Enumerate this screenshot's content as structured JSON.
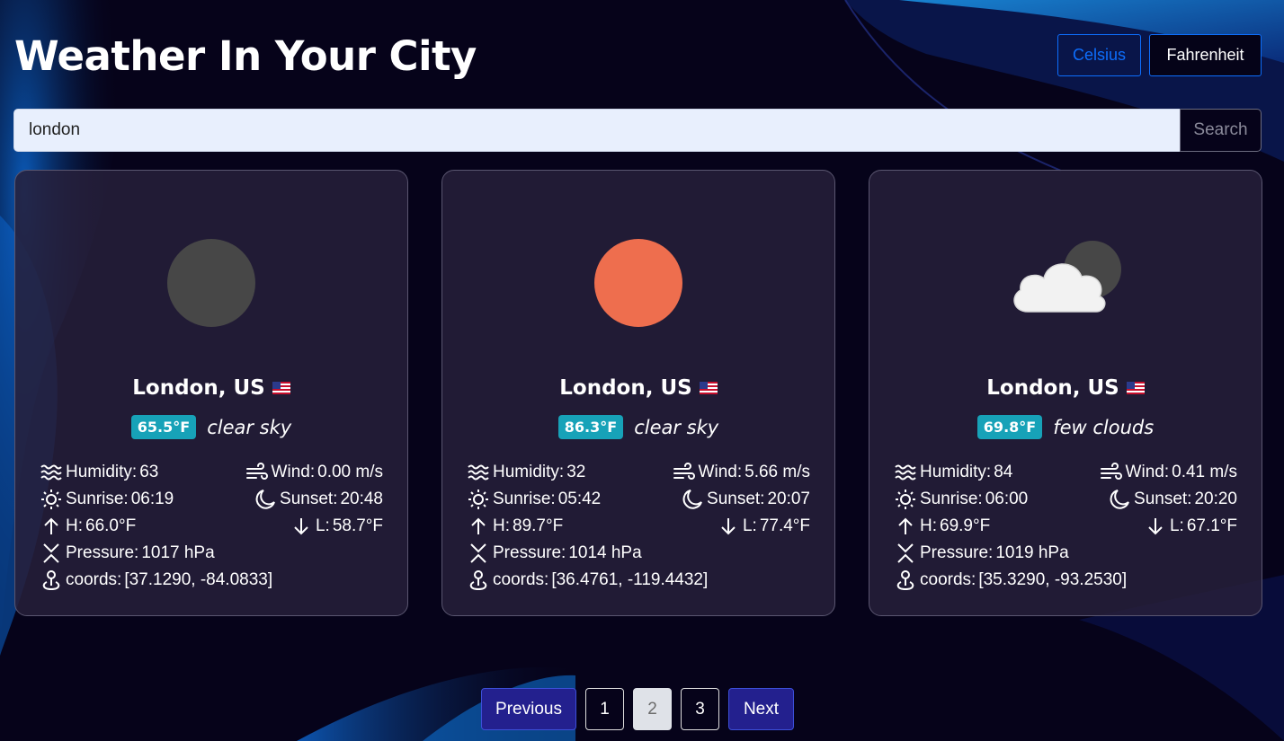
{
  "header": {
    "title": "Weather In Your City",
    "units": {
      "celsius": "Celsius",
      "fahrenheit": "Fahrenheit"
    }
  },
  "search": {
    "value": "london",
    "button": "Search"
  },
  "labels": {
    "humidity": "Humidity: ",
    "wind": "Wind: ",
    "sunrise": "Sunrise: ",
    "sunset": "Sunset: ",
    "high": "H: ",
    "low": "L: ",
    "pressure": "Pressure: ",
    "coords": "coords: "
  },
  "cards": [
    {
      "icon": "moon-icon",
      "city": "London, US",
      "flag": "us-flag-icon",
      "temp": "65.5°F",
      "description": "clear sky",
      "humidity": "63",
      "wind": "0.00 m/s",
      "sunrise": "06:19",
      "sunset": "20:48",
      "high": "66.0°F",
      "low": "58.7°F",
      "pressure": "1017 hPa",
      "coords": "[37.1290, -84.0833]"
    },
    {
      "icon": "sun-icon",
      "city": "London, US",
      "flag": "us-flag-icon",
      "temp": "86.3°F",
      "description": "clear sky",
      "humidity": "32",
      "wind": "5.66 m/s",
      "sunrise": "05:42",
      "sunset": "20:07",
      "high": "89.7°F",
      "low": "77.4°F",
      "pressure": "1014 hPa",
      "coords": "[36.4761, -119.4432]"
    },
    {
      "icon": "cloud-moon-icon",
      "city": "London, US",
      "flag": "us-flag-icon",
      "temp": "69.8°F",
      "description": "few clouds",
      "humidity": "84",
      "wind": "0.41 m/s",
      "sunrise": "06:00",
      "sunset": "20:20",
      "high": "69.9°F",
      "low": "67.1°F",
      "pressure": "1019 hPa",
      "coords": "[35.3290, -93.2530]"
    }
  ],
  "pagination": {
    "previous": "Previous",
    "pages": [
      "1",
      "2",
      "3"
    ],
    "current": "2",
    "next": "Next"
  },
  "colors": {
    "background": "#06031a",
    "accent": "#0d6efd",
    "badge": "#17a2b8",
    "pager_active": "#23208e",
    "sun": "#ee6e4e",
    "moon": "#474747"
  }
}
